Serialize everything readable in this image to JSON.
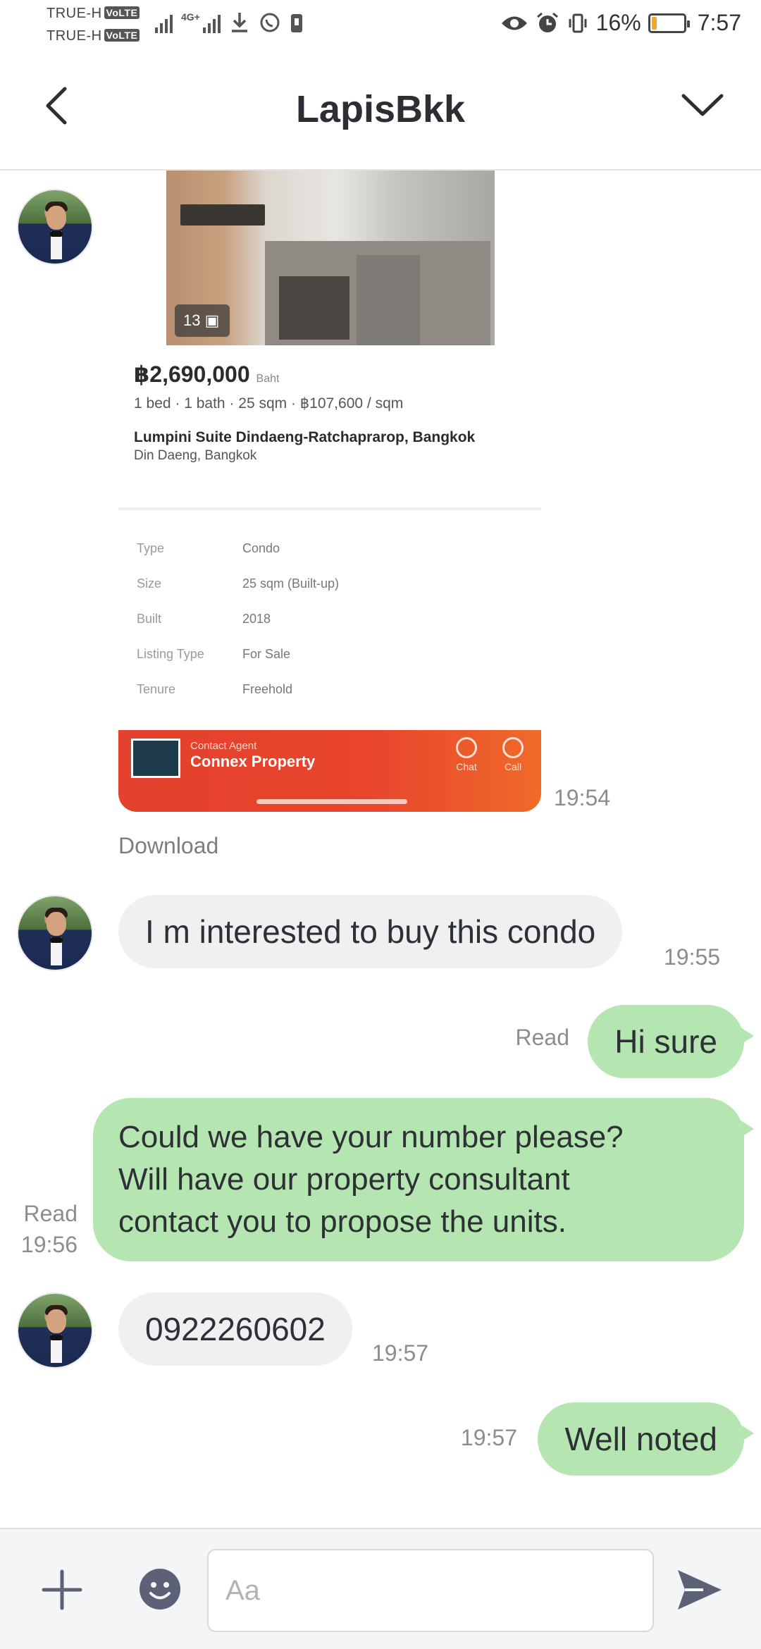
{
  "status_bar": {
    "carrier_1": "TRUE-H",
    "carrier_2": "TRUE-H",
    "volte": "VoLTE",
    "network": "4G+",
    "battery_percent": "16%",
    "battery_level": 0.16,
    "time": "7:57"
  },
  "header": {
    "title": "LapisBkk"
  },
  "listing_card": {
    "photo_count": "13",
    "price": "฿2,690,000",
    "price_unit": "Baht",
    "specs": "1 bed · 1 bath · 25 sqm · ฿107,600 / sqm",
    "project": "Lumpini Suite Dindaeng-Ratchaprarop, Bangkok",
    "address": "Din Daeng, Bangkok",
    "details": [
      {
        "key": "Type",
        "value": "Condo"
      },
      {
        "key": "Size",
        "value": "25 sqm (Built-up)"
      },
      {
        "key": "Built",
        "value": "2018"
      },
      {
        "key": "Listing Type",
        "value": "For Sale"
      },
      {
        "key": "Tenure",
        "value": "Freehold"
      }
    ],
    "agent_label": "Contact Agent",
    "agent_name": "Connex Property",
    "action_chat": "Chat",
    "action_call": "Call",
    "time": "19:54"
  },
  "download_label": "Download",
  "messages": [
    {
      "text": "I m interested to buy this condo",
      "time": "19:55"
    },
    {
      "text": "Hi sure",
      "status": "Read"
    },
    {
      "line1": "Could we have your number please?",
      "line2": "Will have our property consultant",
      "line3": "contact you to propose the units.",
      "status": "Read",
      "time": "19:56"
    },
    {
      "text": "0922260602",
      "time": "19:57"
    },
    {
      "text": "Well noted",
      "time": "19:57"
    }
  ],
  "input": {
    "placeholder": "Aa"
  },
  "colors": {
    "outgoing_bubble": "#b5e6b1",
    "incoming_bubble": "#eff0f2",
    "agent_bar": "#e4412f",
    "battery_low": "#f5a623"
  }
}
